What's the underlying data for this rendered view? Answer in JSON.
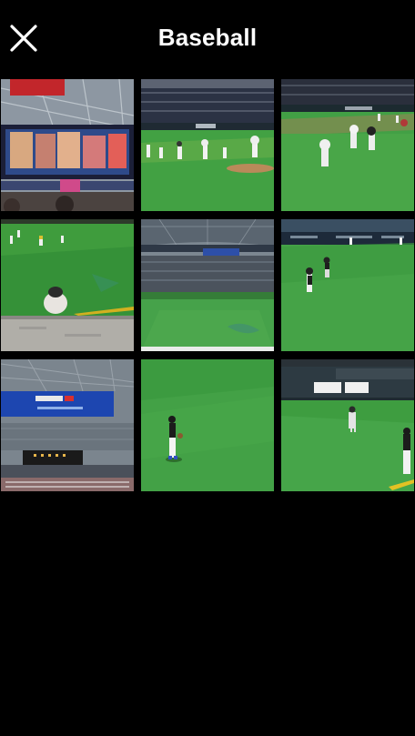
{
  "header": {
    "title": "Baseball",
    "close_icon": "close-icon"
  },
  "album": {
    "photos": [
      {
        "name": "photo-1",
        "scene": "stadium-screen"
      },
      {
        "name": "photo-2",
        "scene": "infield-mascots"
      },
      {
        "name": "photo-3",
        "scene": "infield-mascots"
      },
      {
        "name": "photo-4",
        "scene": "outfield-fans"
      },
      {
        "name": "photo-5",
        "scene": "dome-overview"
      },
      {
        "name": "photo-6",
        "scene": "outfield-players"
      },
      {
        "name": "photo-7",
        "scene": "dome-scoreboard"
      },
      {
        "name": "photo-8",
        "scene": "outfield-player"
      },
      {
        "name": "photo-9",
        "scene": "outfield-wall"
      }
    ]
  },
  "colors": {
    "background": "#000000",
    "grass": "#3f9a3a",
    "grass_dark": "#2f7f2e",
    "stands": "#2a2f3a",
    "sky_dome": "#6e7b86"
  }
}
